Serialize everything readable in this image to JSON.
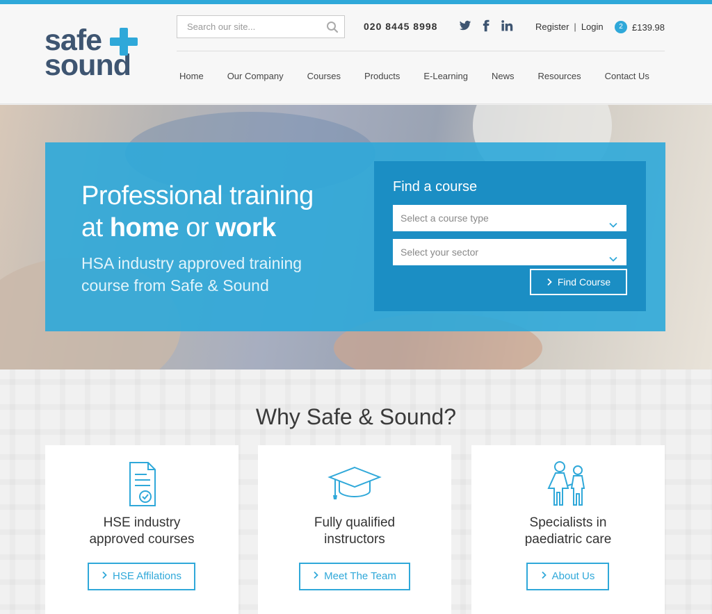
{
  "brand": {
    "line1": "safe",
    "line2": "sound",
    "accent_color": "#2fa8d9",
    "text_color": "#3e5571"
  },
  "search": {
    "placeholder": "Search our site..."
  },
  "header": {
    "phone": "020 8445 8998",
    "social": [
      "twitter-icon",
      "facebook-icon",
      "linkedin-icon"
    ],
    "register_label": "Register",
    "separator": "|",
    "login_label": "Login",
    "basket_count": "2",
    "basket_total": "£139.98"
  },
  "nav": {
    "items": [
      {
        "label": "Home"
      },
      {
        "label": "Our Company"
      },
      {
        "label": "Courses"
      },
      {
        "label": "Products"
      },
      {
        "label": "E-Learning"
      },
      {
        "label": "News"
      },
      {
        "label": "Resources"
      },
      {
        "label": "Contact Us"
      }
    ]
  },
  "hero": {
    "headline_line1": "Professional training",
    "headline_at": "at",
    "headline_home": "home",
    "headline_or": "or",
    "headline_work": "work",
    "sub_line1": "HSA industry approved training",
    "sub_line2": "course from Safe & Sound"
  },
  "finder": {
    "title": "Find a course",
    "course_type_placeholder": "Select a course type",
    "sector_placeholder": "Select your sector",
    "button_label": "Find Course"
  },
  "why": {
    "title": "Why Safe & Sound?",
    "cards": [
      {
        "icon": "certificate-icon",
        "title_line1": "HSE industry",
        "title_line2": "approved courses",
        "button_label": "HSE Affilations"
      },
      {
        "icon": "graduation-cap-icon",
        "title_line1": "Fully qualified",
        "title_line2": "instructors",
        "button_label": "Meet The Team"
      },
      {
        "icon": "children-icon",
        "title_line1": "Specialists in",
        "title_line2": "paediatric care",
        "button_label": "About Us"
      }
    ]
  }
}
